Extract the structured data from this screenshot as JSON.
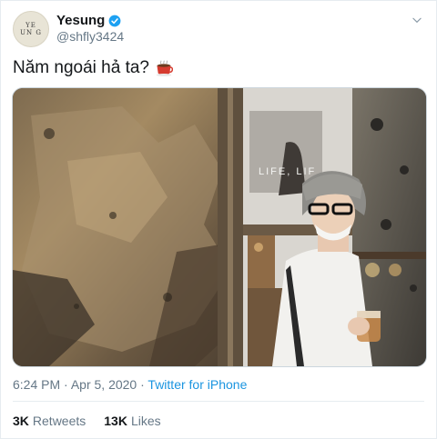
{
  "author": {
    "display_name": "Yesung",
    "handle": "@shfly3424",
    "avatar_text": "YE UN G",
    "verified": true
  },
  "tweet": {
    "text": "Năm ngoái hả ta?",
    "emoji": "coffee-cup-icon",
    "photo_caption": "LIFE, LIF"
  },
  "meta": {
    "time": "6:24 PM",
    "separator": "·",
    "date": "Apr 5, 2020",
    "source": "Twitter for iPhone"
  },
  "stats": {
    "retweets_count": "3K",
    "retweets_label": "Retweets",
    "likes_count": "13K",
    "likes_label": "Likes"
  },
  "colors": {
    "link": "#1b95e0",
    "muted": "#657786",
    "text": "#14171a",
    "divider": "#e6ecf0"
  }
}
